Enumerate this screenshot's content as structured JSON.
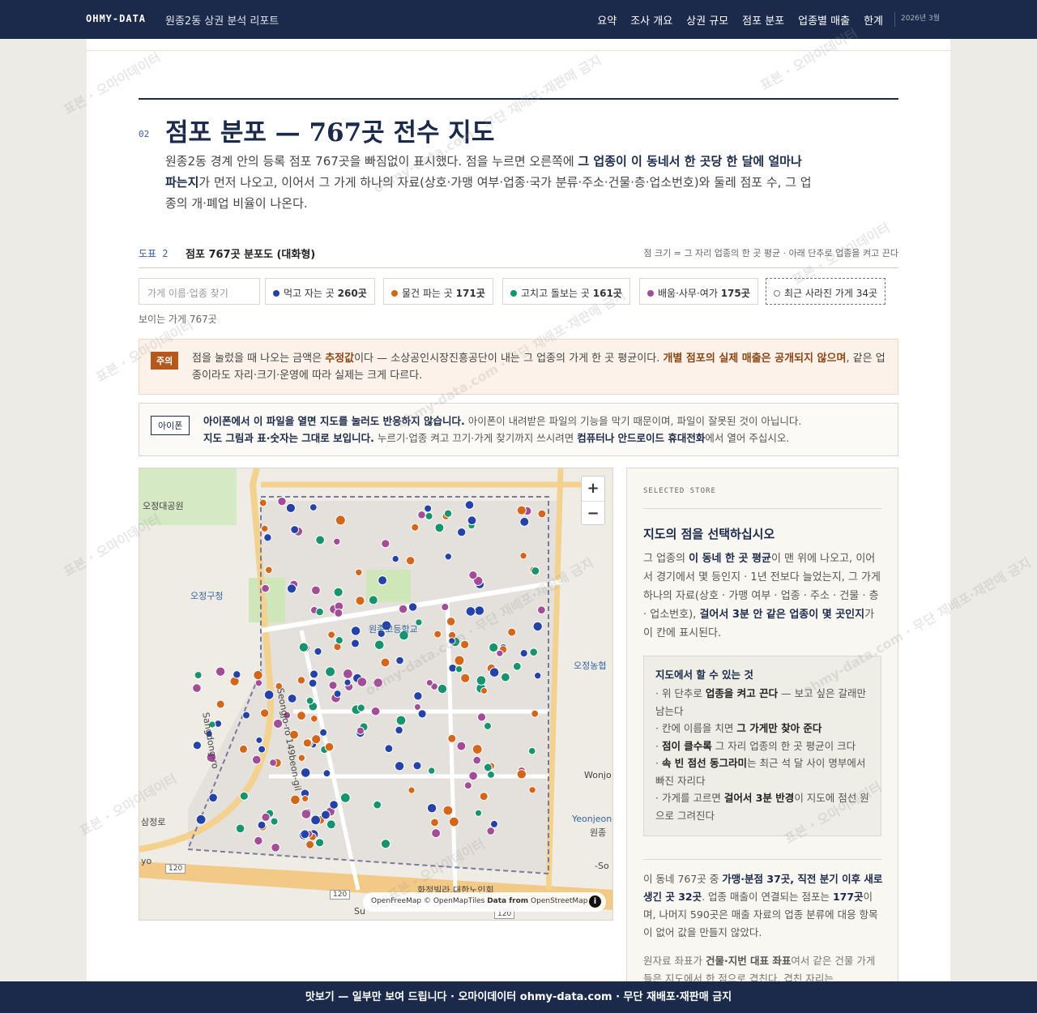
{
  "header": {
    "brand": "OHMY-DATA",
    "report_title": "원종2동 상권 분석 리포트",
    "nav": [
      "요약",
      "조사 개요",
      "상권 규모",
      "점포 분포",
      "업종별 매출",
      "한계"
    ],
    "date": "2026년 3월"
  },
  "section": {
    "number": "02",
    "title": "점포 분포 — 767곳 전수 지도",
    "intro_1": "원종2동 경계 안의 등록 점포 767곳을 빠짐없이 표시했다. 점을 누르면 오른쪽에 ",
    "intro_bold": "그 업종이 이 동네서 한 곳당 한 달에 얼마나 파는지",
    "intro_2": "가 먼저 나오고, 이어서 그 가게 하나의 자료(상호·가맹 여부·업종·국가 분류·주소·건물·층·업소번호)와 둘레 점포 수, 그 업종의 개·폐업 비율이 나온다."
  },
  "figure": {
    "label": "도표 2",
    "title": "점포 767곳 분포도 (대화형)",
    "note": "점 크기 = 그 자리 업종의 한 곳 평균 · 아래 단추로 업종을 켜고 끈다"
  },
  "filters": {
    "search_placeholder": "가게 이름·업종 찾기",
    "chips": [
      {
        "label": "먹고 자는 곳",
        "count": "260곳",
        "color": "#2442a8"
      },
      {
        "label": "물건 파는 곳",
        "count": "171곳",
        "color": "#d4661a"
      },
      {
        "label": "고치고 돌보는 곳",
        "count": "161곳",
        "color": "#17936e"
      },
      {
        "label": "배움·사무·여가",
        "count": "175곳",
        "color": "#a34c98"
      }
    ],
    "gone_chip": "최근 사라진 가게 34곳",
    "visible": "보이는 가게 767곳"
  },
  "caution": {
    "tag": "주의",
    "t1": "점을 눌렀을 때 나오는 금액은 ",
    "b1": "추정값",
    "t2": "이다 — 소상공인시장진흥공단이 내는 그 업종의 가게 한 곳 평균이다. ",
    "b2": "개별 점포의 실제 매출은 공개되지 않으며",
    "t3": ", 같은 업종이라도 자리·크기·운영에 따라 실제는 크게 다르다."
  },
  "iphone": {
    "tag": "아이폰",
    "b1": "아이폰에서 이 파일을 열면 지도를 눌러도 반응하지 않습니다.",
    "t1": " 아이폰이 내려받은 파일의 기능을 막기 때문이며, 파일이 잘못된 것이 아닙니다.",
    "b2": "지도 그림과 표·숫자는 그대로 보입니다.",
    "t2": " 누르기·업종 켜고 끄기·가게 찾기까지 쓰시려면 ",
    "b3": "컴퓨터나 안드로이드 휴대전화",
    "t3": "에서 열어 주십시오."
  },
  "map": {
    "zoom_in": "+",
    "zoom_out": "−",
    "attribution_a": "OpenFreeMap © OpenMapTiles ",
    "attribution_b": "Data from",
    "attribution_c": " OpenStreetMap",
    "info": "i",
    "labels": {
      "park": "오정대공원",
      "office": "오정구청",
      "school": "원종고등학교",
      "coop": "오정농협",
      "road1": "Sangdong-ro",
      "road2": "Seongjo-ro 149beon-gil",
      "wonjo": "Wonjo",
      "yeonjeong": "Yeonjeong",
      "wonjong": "원종",
      "so": "-So",
      "samjeong": "삼정로",
      "yo": "yo",
      "hospital": "화정빌라,대한노인회",
      "route1": "120",
      "route2": "120",
      "route3": "120",
      "su": "Su"
    }
  },
  "side": {
    "eyebrow": "SELECTED STORE",
    "title": "지도의 점을 선택하십시오",
    "p1a": "그 업종의 ",
    "p1b": "이 동네 한 곳 평균",
    "p1c": "이 맨 위에 나오고, 이어서 경기에서 몇 등인지 · 1년 전보다 늘었는지, 그 가게 하나의 자료(상호 · 가맹 여부 · 업종 · 주소 · 건물 · 층 · 업소번호), ",
    "p1d": "걸어서 3분 안 같은 업종이 몇 곳인지",
    "p1e": "가 이 칸에 표시된다.",
    "box_title": "지도에서 할 수 있는 것",
    "box_items": [
      {
        "pre": "· 위 단추로 ",
        "b": "업종을 켜고 끈다",
        "post": " — 보고 싶은 갈래만 남는다"
      },
      {
        "pre": "· 칸에 이름을 치면 ",
        "b": "그 가게만 찾아 준다",
        "post": ""
      },
      {
        "pre": "· ",
        "b": "점이 클수록",
        "post": " 그 자리 업종의 한 곳 평균이 크다"
      },
      {
        "pre": "· ",
        "b": "속 빈 점선 동그라미",
        "post": "는 최근 석 달 사이 명부에서 빠진 자리다"
      },
      {
        "pre": "· 가게를 고르면 ",
        "b": "걸어서 3분 반경",
        "post": "이 지도에 점선 원으로 그려진다"
      }
    ],
    "p2a": "이 동네 767곳 중 ",
    "p2b": "가맹·분점 37곳, 직전 분기 이후 새로 생긴 곳 32곳",
    "p2c": ". 업종 매출이 연결되는 점포는 ",
    "p2d": "177곳",
    "p2e": "이며, 나머지 590곳은 매출 자료의 업종 분류에 대응 항목이 없어 값을 만들지 않았다.",
    "p3a": "원자료 좌표가 ",
    "p3b": "건물·지번 대표 좌표",
    "p3c": "여서 같은 건물 가게들은 지도에서 한 점으로 겹친다. 겹친 자리는"
  },
  "footer": "맛보기 — 일부만 보여 드립니다 · 오마이데이터 ohmy-data.com · 무단 재배포·재판매 금지",
  "watermark": [
    "표본 · 오마이데이터",
    "ohmy-data.com · 무단 재배포·재판매 금지"
  ]
}
